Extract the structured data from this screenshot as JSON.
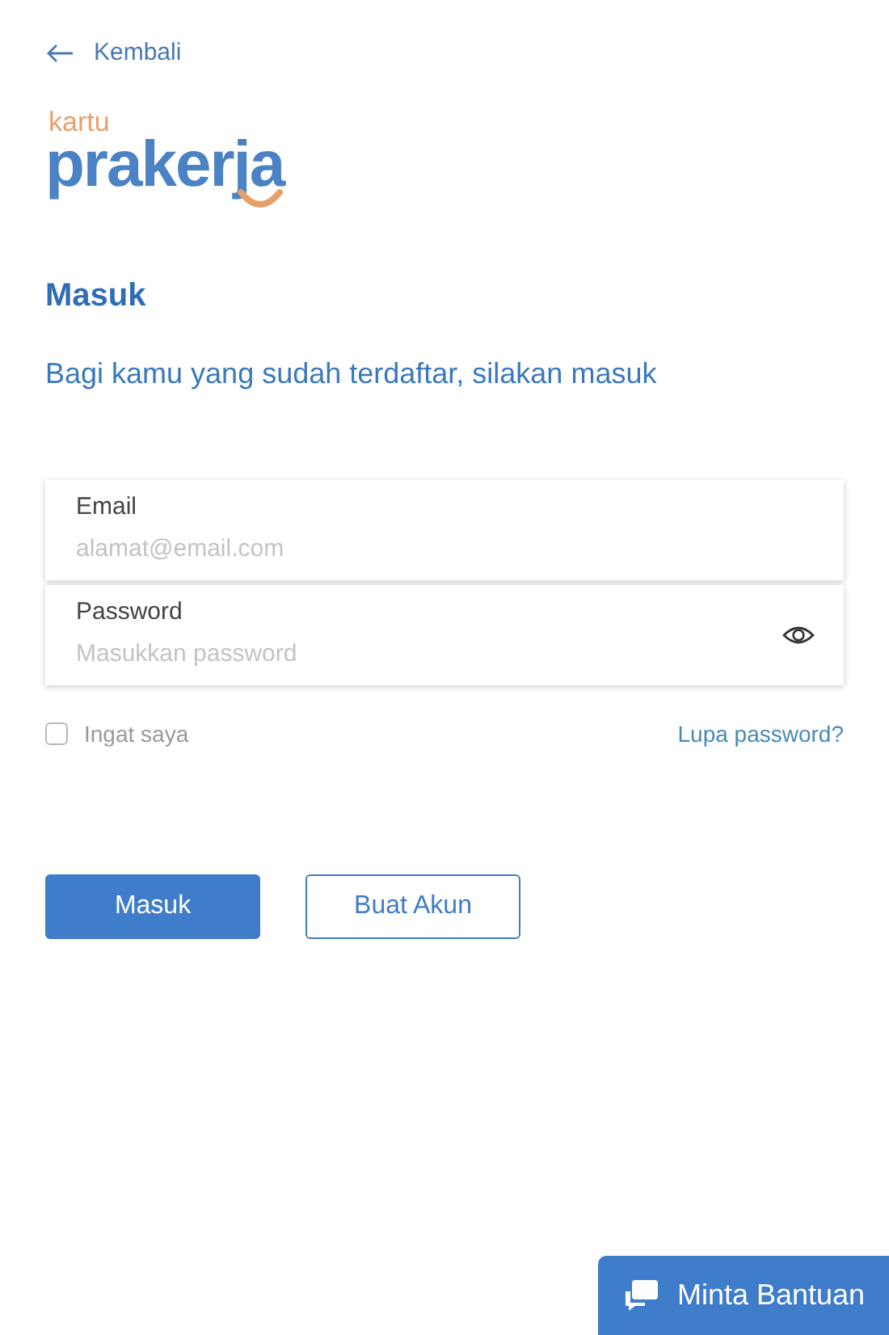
{
  "back_link": {
    "label": "Kembali"
  },
  "logo": {
    "top": "kartu",
    "main": "prakerja"
  },
  "title": "Masuk",
  "subtitle": "Bagi kamu yang sudah terdaftar, silakan masuk",
  "fields": [
    {
      "kind": "text",
      "label": "Email",
      "placeholder": "alamat@email.com"
    },
    {
      "kind": "password",
      "label": "Password",
      "placeholder": "Masukkan password"
    }
  ],
  "remember": {
    "label": "Ingat saya",
    "checked": false
  },
  "forgot_link": "Lupa password?",
  "buttons": [
    {
      "kind": "primary",
      "label": "Masuk"
    },
    {
      "kind": "outline",
      "label": "Buat Akun"
    }
  ],
  "help_button": {
    "label": "Minta Bantuan"
  }
}
